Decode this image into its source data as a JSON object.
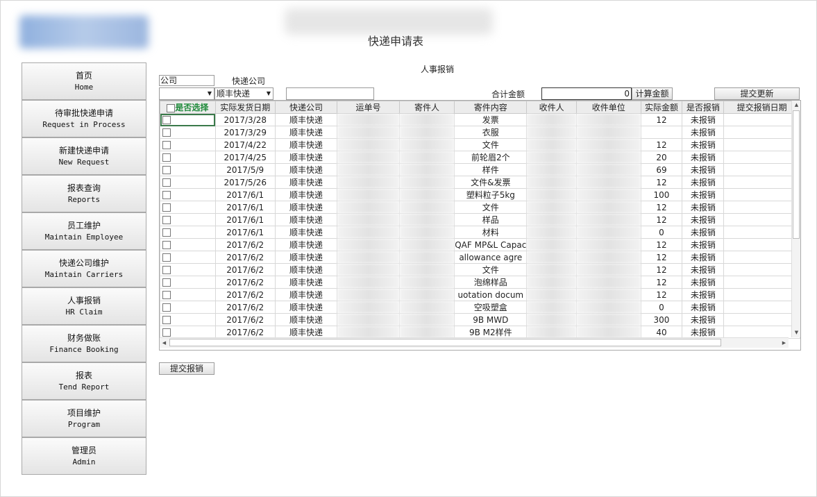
{
  "header": {
    "page_title": "快递申请表"
  },
  "nav": [
    {
      "zh": "首页",
      "en": "Home"
    },
    {
      "zh": "待审批快递申请",
      "en": "Request in Process"
    },
    {
      "zh": "新建快递申请",
      "en": "New Request"
    },
    {
      "zh": "报表查询",
      "en": "Reports"
    },
    {
      "zh": "员工维护",
      "en": "Maintain Employee"
    },
    {
      "zh": "快递公司维护",
      "en": "Maintain Carriers"
    },
    {
      "zh": "人事报销",
      "en": "HR Claim"
    },
    {
      "zh": "财务做账",
      "en": "Finance Booking"
    },
    {
      "zh": "报表",
      "en": "Tend Report"
    },
    {
      "zh": "项目维护",
      "en": "Program"
    },
    {
      "zh": "管理员",
      "en": "Admin"
    }
  ],
  "form": {
    "section_title": "人事报销",
    "company_label": "公司",
    "company_value": "",
    "carrier_label": "快递公司",
    "carrier_value": "顺丰快递",
    "total_label": "合计金额",
    "total_value": "0",
    "calc_button": "计算金额",
    "submit_update_button": "提交更新",
    "submit_claim_button": "提交报销"
  },
  "table": {
    "columns": [
      "是否选择",
      "实际发货日期",
      "快递公司",
      "运单号",
      "寄件人",
      "寄件内容",
      "收件人",
      "收件单位",
      "实际金额",
      "是否报销",
      "提交报销日期"
    ],
    "rows": [
      {
        "date": "2017/3/28",
        "carrier": "顺丰快递",
        "content": "发票",
        "amount": "12",
        "status": "未报销"
      },
      {
        "date": "2017/3/29",
        "carrier": "顺丰快递",
        "content": "衣服",
        "amount": "",
        "status": "未报销"
      },
      {
        "date": "2017/4/22",
        "carrier": "顺丰快递",
        "content": "文件",
        "amount": "12",
        "status": "未报销"
      },
      {
        "date": "2017/4/25",
        "carrier": "顺丰快递",
        "content": "前轮眉2个",
        "amount": "20",
        "status": "未报销"
      },
      {
        "date": "2017/5/9",
        "carrier": "顺丰快递",
        "content": "样件",
        "amount": "69",
        "status": "未报销"
      },
      {
        "date": "2017/5/26",
        "carrier": "顺丰快递",
        "content": "文件&发票",
        "amount": "12",
        "status": "未报销"
      },
      {
        "date": "2017/6/1",
        "carrier": "顺丰快递",
        "content": "塑料粒子5kg",
        "amount": "100",
        "status": "未报销"
      },
      {
        "date": "2017/6/1",
        "carrier": "顺丰快递",
        "content": "文件",
        "amount": "12",
        "status": "未报销"
      },
      {
        "date": "2017/6/1",
        "carrier": "顺丰快递",
        "content": "样品",
        "amount": "12",
        "status": "未报销"
      },
      {
        "date": "2017/6/1",
        "carrier": "顺丰快递",
        "content": "材料",
        "amount": "0",
        "status": "未报销"
      },
      {
        "date": "2017/6/2",
        "carrier": "顺丰快递",
        "content": "QAF MP&L Capac",
        "amount": "12",
        "status": "未报销"
      },
      {
        "date": "2017/6/2",
        "carrier": "顺丰快递",
        "content": "allowance agre",
        "amount": "12",
        "status": "未报销"
      },
      {
        "date": "2017/6/2",
        "carrier": "顺丰快递",
        "content": "文件",
        "amount": "12",
        "status": "未报销"
      },
      {
        "date": "2017/6/2",
        "carrier": "顺丰快递",
        "content": "泡绵样品",
        "amount": "12",
        "status": "未报销"
      },
      {
        "date": "2017/6/2",
        "carrier": "顺丰快递",
        "content": "uotation docum",
        "amount": "12",
        "status": "未报销"
      },
      {
        "date": "2017/6/2",
        "carrier": "顺丰快递",
        "content": "空吸塑盒",
        "amount": "0",
        "status": "未报销"
      },
      {
        "date": "2017/6/2",
        "carrier": "顺丰快递",
        "content": "9B MWD",
        "amount": "300",
        "status": "未报销"
      },
      {
        "date": "2017/6/2",
        "carrier": "顺丰快递",
        "content": "9B M2样件",
        "amount": "40",
        "status": "未报销"
      }
    ]
  }
}
